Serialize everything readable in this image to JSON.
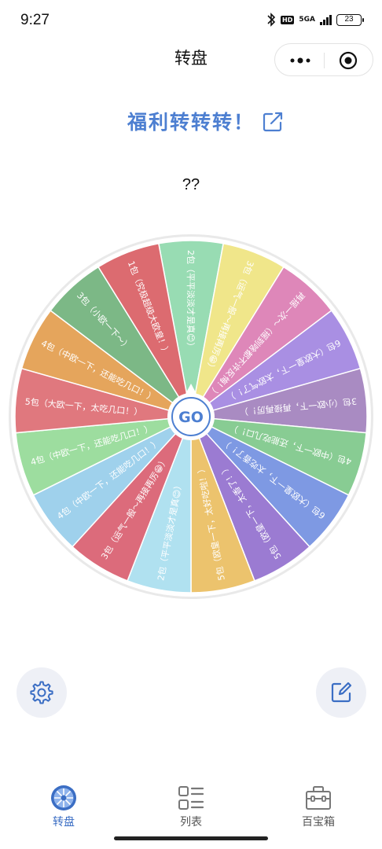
{
  "status_bar": {
    "time": "9:27",
    "hd": "HD",
    "network": "5GA",
    "battery": "23"
  },
  "nav": {
    "title": "转盘"
  },
  "wheel": {
    "title": "福利转转转！",
    "result": "??",
    "center_label": "GO",
    "segments": [
      {
        "label": "2包（平平淡淡才是真😊）",
        "color": "#98dcb3"
      },
      {
        "label": "3包（运气一般～再接再厉😁）",
        "color": "#f0e68a"
      },
      {
        "label": "再摇一次～（摇到啥都不许反悔！）",
        "color": "#de87b9"
      },
      {
        "label": "6包（大欧皇一下，太欧气了！）",
        "color": "#a98fe3"
      },
      {
        "label": "3包（小欧一下，再接再厉！）",
        "color": "#a98bc2"
      },
      {
        "label": "4包（中欧一下，还能吃几口！）",
        "color": "#88cc93"
      },
      {
        "label": "6包（大欧皇一下，太吃香了！）",
        "color": "#7e99e3"
      },
      {
        "label": "5包（欧皇一下，太香了！）",
        "color": "#9b7bd2"
      },
      {
        "label": "5包（欧皇一下，太好吃啦！）",
        "color": "#ecc36d"
      },
      {
        "label": "2包（平平淡淡才是真😊）",
        "color": "#b0e1f0"
      },
      {
        "label": "3包（运气一般～再接再厉😁）",
        "color": "#dc6b7b"
      },
      {
        "label": "4包（中欧一下，还能吃几口！）",
        "color": "#9fd1ec"
      },
      {
        "label": "4包（中欧一下，还能吃几口！）",
        "color": "#9ddd9f"
      },
      {
        "label": "5包（大欧一下，太吃几口！）",
        "color": "#e0787e"
      },
      {
        "label": "4包（中欧一下，还能吃几口！）",
        "color": "#e5a55c"
      },
      {
        "label": "3包（小欧一下～）",
        "color": "#7cb886"
      },
      {
        "label": "1包（究极超级大欧皇！）",
        "color": "#dc6b70"
      }
    ]
  },
  "tabs": [
    {
      "label": "转盘",
      "icon": "turntable-icon",
      "active": true
    },
    {
      "label": "列表",
      "icon": "list-icon",
      "active": false
    },
    {
      "label": "百宝箱",
      "icon": "toolbox-icon",
      "active": false
    }
  ],
  "colors": {
    "accent": "#4d7fd1",
    "tab_active": "#3b6ec4",
    "button_bg": "#eef0f6"
  }
}
